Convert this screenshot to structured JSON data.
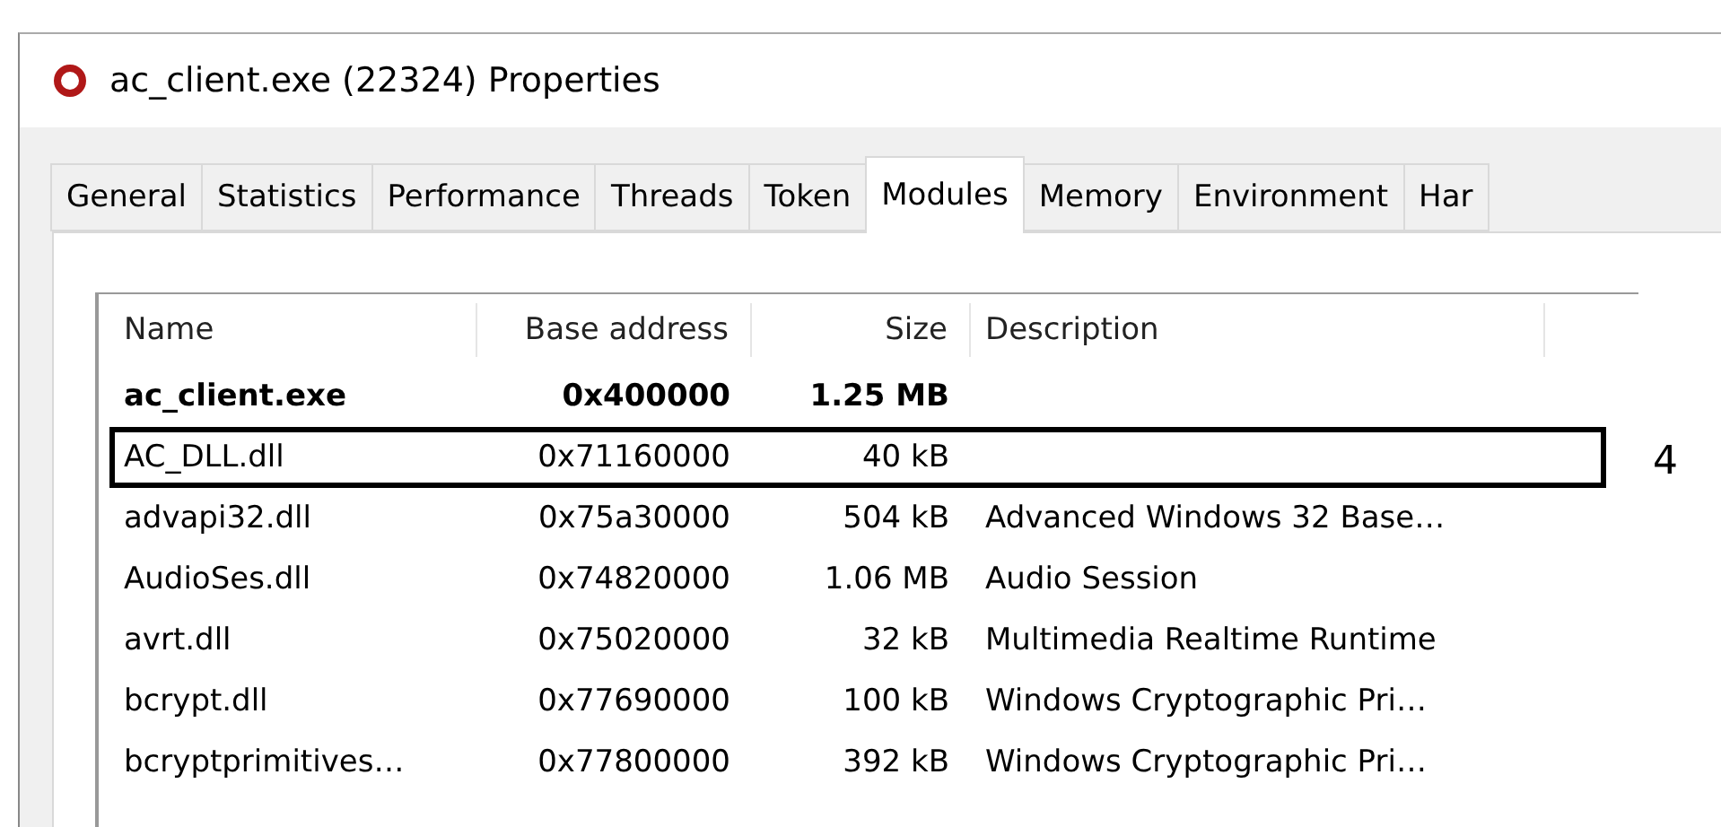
{
  "window": {
    "title": "ac_client.exe (22324) Properties"
  },
  "tabs": [
    {
      "label": "General",
      "selected": false
    },
    {
      "label": "Statistics",
      "selected": false
    },
    {
      "label": "Performance",
      "selected": false
    },
    {
      "label": "Threads",
      "selected": false
    },
    {
      "label": "Token",
      "selected": false
    },
    {
      "label": "Modules",
      "selected": true
    },
    {
      "label": "Memory",
      "selected": false
    },
    {
      "label": "Environment",
      "selected": false
    },
    {
      "label": "Har",
      "selected": false
    }
  ],
  "table": {
    "columns": [
      "Name",
      "Base address",
      "Size",
      "Description"
    ],
    "rows": [
      {
        "kind": "process",
        "highlighted": false,
        "cells": [
          "ac_client.exe",
          "0x400000",
          "1.25 MB",
          ""
        ]
      },
      {
        "kind": "module",
        "highlighted": true,
        "cells": [
          "AC_DLL.dll",
          "0x71160000",
          "40 kB",
          ""
        ]
      },
      {
        "kind": "module",
        "highlighted": false,
        "cells": [
          "advapi32.dll",
          "0x75a30000",
          "504 kB",
          "Advanced Windows 32 Base…"
        ]
      },
      {
        "kind": "module",
        "highlighted": false,
        "cells": [
          "AudioSes.dll",
          "0x74820000",
          "1.06 MB",
          "Audio Session"
        ]
      },
      {
        "kind": "module",
        "highlighted": false,
        "cells": [
          "avrt.dll",
          "0x75020000",
          "32 kB",
          "Multimedia Realtime Runtime"
        ]
      },
      {
        "kind": "module",
        "highlighted": false,
        "cells": [
          "bcrypt.dll",
          "0x77690000",
          "100 kB",
          "Windows Cryptographic Pri…"
        ]
      },
      {
        "kind": "module",
        "highlighted": false,
        "cells": [
          "bcryptprimitives…",
          "0x77800000",
          "392 kB",
          "Windows Cryptographic Pri…"
        ]
      }
    ]
  },
  "annotation": {
    "label": "4"
  }
}
